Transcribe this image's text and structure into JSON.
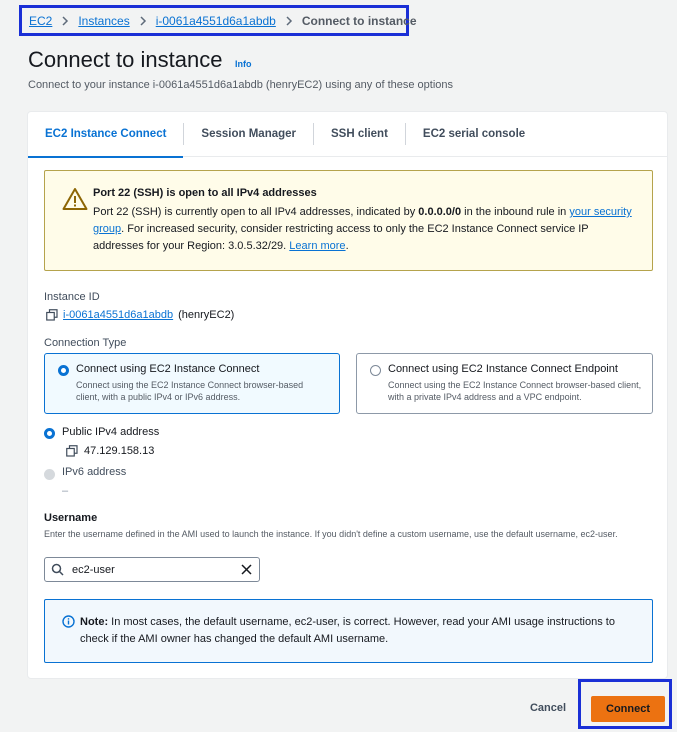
{
  "breadcrumb": {
    "items": [
      "EC2",
      "Instances",
      "i-0061a4551d6a1abdb"
    ],
    "current": "Connect to instance"
  },
  "header": {
    "title": "Connect to instance",
    "info_label": "Info",
    "subtitle": "Connect to your instance i-0061a4551d6a1abdb (henryEC2) using any of these options"
  },
  "tabs": [
    {
      "label": "EC2 Instance Connect",
      "active": true
    },
    {
      "label": "Session Manager",
      "active": false
    },
    {
      "label": "SSH client",
      "active": false
    },
    {
      "label": "EC2 serial console",
      "active": false
    }
  ],
  "warning": {
    "title": "Port 22 (SSH) is open to all IPv4 addresses",
    "body_part1": "Port 22 (SSH) is currently open to all IPv4 addresses, indicated by ",
    "body_bold": "0.0.0.0/0",
    "body_part2": " in the inbound rule in ",
    "link1": "your security group",
    "body_part3": ". For increased security, consider restricting access to only the EC2 Instance Connect service IP addresses for your Region: 3.0.5.32/29. ",
    "link2": "Learn more",
    "body_end": "."
  },
  "instance": {
    "label": "Instance ID",
    "id": "i-0061a4551d6a1abdb",
    "name": "(henryEC2)"
  },
  "connection_type": {
    "label": "Connection Type",
    "options": [
      {
        "title": "Connect using EC2 Instance Connect",
        "desc": "Connect using the EC2 Instance Connect browser-based client, with a public IPv4 or IPv6 address.",
        "selected": true
      },
      {
        "title": "Connect using EC2 Instance Connect Endpoint",
        "desc": "Connect using the EC2 Instance Connect browser-based client, with a private IPv4 address and a VPC endpoint.",
        "selected": false
      }
    ]
  },
  "address": {
    "public_ipv4_label": "Public IPv4 address",
    "public_ipv4_value": "47.129.158.13",
    "ipv6_label": "IPv6 address",
    "ipv6_value": "–"
  },
  "username": {
    "label": "Username",
    "help": "Enter the username defined in the AMI used to launch the instance. If you didn't define a custom username, use the default username, ec2-user.",
    "value": "ec2-user"
  },
  "note": {
    "bold": "Note:",
    "text": " In most cases, the default username, ec2-user, is correct. However, read your AMI usage instructions to check if the AMI owner has changed the default AMI username."
  },
  "footer": {
    "cancel_label": "Cancel",
    "connect_label": "Connect"
  },
  "colors": {
    "accent": "#0972d3",
    "primary_button": "#ec7211",
    "warning_bg": "#fffce9",
    "info_bg": "#f2f8fd",
    "highlight_box": "#1a2fd6"
  }
}
